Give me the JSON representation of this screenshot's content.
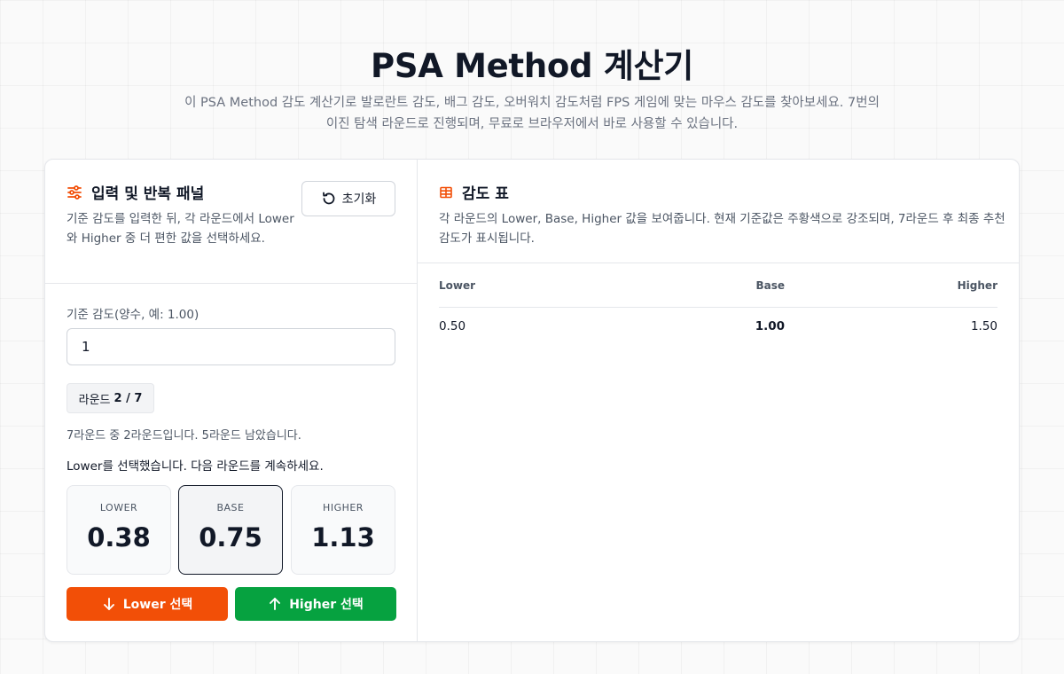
{
  "header": {
    "title": "PSA Method 계산기",
    "subtitle": "이 PSA Method 감도 계산기로 발로란트 감도, 배그 감도, 오버워치 감도처럼 FPS 게임에 맞는 마우스 감도를 찾아보세요. 7번의 이진 탐색 라운드로 진행되며, 무료로 브라우저에서 바로 사용할 수 있습니다."
  },
  "left_panel": {
    "title": "입력 및 반복 패널",
    "description": "기준 감도를 입력한 뒤, 각 라운드에서 Lower와 Higher 중 더 편한 값을 선택하세요.",
    "reset_label": "초기화",
    "input_label": "기준 감도(양수, 예: 1.00)",
    "input_value": "1",
    "round_prefix": "라운드",
    "round_value": "2 / 7",
    "round_info": "7라운드 중 2라운드입니다. 5라운드 남았습니다.",
    "status_message": "Lower를 선택했습니다. 다음 라운드를 계속하세요.",
    "values": {
      "lower_label": "LOWER",
      "lower_value": "0.38",
      "base_label": "BASE",
      "base_value": "0.75",
      "higher_label": "HIGHER",
      "higher_value": "1.13"
    },
    "lower_button": "Lower 선택",
    "higher_button": "Higher 선택"
  },
  "right_panel": {
    "title": "감도 표",
    "description": "각 라운드의 Lower, Base, Higher 값을 보여줍니다. 현재 기준값은 주황색으로 강조되며, 7라운드 후 최종 추천 감도가 표시됩니다.",
    "columns": [
      "Lower",
      "Base",
      "Higher"
    ],
    "rows": [
      [
        "0.50",
        "1.00",
        "1.50"
      ]
    ]
  },
  "colors": {
    "accent_orange": "#f24f07",
    "accent_green": "#06a240",
    "text_dark": "#111827",
    "text_muted": "#4b5563"
  }
}
